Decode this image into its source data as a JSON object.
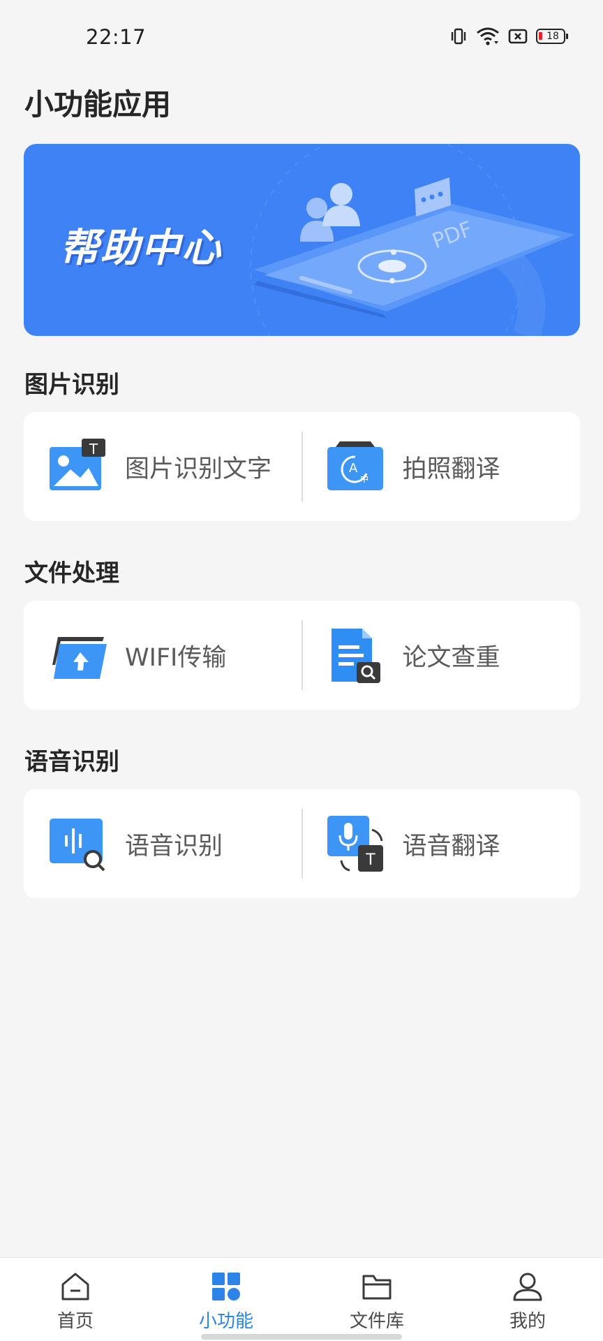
{
  "status_bar": {
    "time": "22:17",
    "battery_level": "18",
    "icons": [
      "vibrate-icon",
      "wifi-icon",
      "sim-error-icon",
      "battery-icon"
    ]
  },
  "page": {
    "title": "小功能应用"
  },
  "banner": {
    "title": "帮助中心",
    "accent_color": "#3f82f5"
  },
  "sections": [
    {
      "title": "图片识别",
      "items": [
        {
          "label": "图片识别文字",
          "icon": "image-text-icon"
        },
        {
          "label": "拍照翻译",
          "icon": "photo-translate-icon"
        }
      ]
    },
    {
      "title": "文件处理",
      "items": [
        {
          "label": "WIFI传输",
          "icon": "wifi-transfer-icon"
        },
        {
          "label": "论文查重",
          "icon": "paper-check-icon"
        }
      ]
    },
    {
      "title": "语音识别",
      "items": [
        {
          "label": "语音识别",
          "icon": "voice-recognition-icon"
        },
        {
          "label": "语音翻译",
          "icon": "voice-translate-icon"
        }
      ]
    }
  ],
  "tab_bar": {
    "active_color": "#2c83e8",
    "tabs": [
      {
        "label": "首页",
        "icon": "home-icon",
        "active": false
      },
      {
        "label": "小功能",
        "icon": "apps-grid-icon",
        "active": true
      },
      {
        "label": "文件库",
        "icon": "folder-icon",
        "active": false
      },
      {
        "label": "我的",
        "icon": "profile-icon",
        "active": false
      }
    ]
  }
}
